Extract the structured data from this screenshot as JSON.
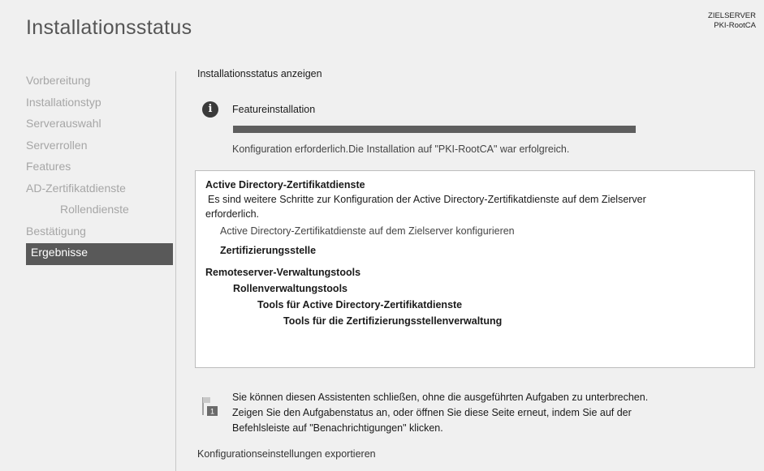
{
  "header": {
    "title": "Installationsstatus",
    "target_server_label": "ZIELSERVER",
    "target_server_name": "PKI-RootCA"
  },
  "sidebar": {
    "items": [
      {
        "label": "Vorbereitung"
      },
      {
        "label": "Installationstyp"
      },
      {
        "label": "Serverauswahl"
      },
      {
        "label": "Serverrollen"
      },
      {
        "label": "Features"
      },
      {
        "label": "AD-Zertifikatdienste"
      },
      {
        "label": "Rollendienste"
      },
      {
        "label": "Bestätigung"
      },
      {
        "label": "Ergebnisse"
      }
    ]
  },
  "main": {
    "heading": "Installationsstatus anzeigen",
    "feature_label": "Featureinstallation",
    "progress_fraction": 1.0,
    "status_text": "Konfiguration erforderlich.Die Installation auf \"PKI-RootCA\" war erfolgreich.",
    "results": {
      "line1": "Active Directory-Zertifikatdienste",
      "line2": "Es sind weitere Schritte zur Konfiguration der Active Directory-Zertifikatdienste auf dem Zielserver",
      "line3": "erforderlich.",
      "line4": "Active Directory-Zertifikatdienste auf dem Zielserver konfigurieren",
      "line5": "Zertifizierungsstelle",
      "line6": "Remoteserver-Verwaltungstools",
      "line7": "Rollenverwaltungstools",
      "line8": "Tools für Active Directory-Zertifikatdienste",
      "line9": "Tools für die Zertifizierungsstellenverwaltung"
    },
    "notice": {
      "line1": "Sie können diesen Assistenten schließen, ohne die ausgeführten Aufgaben zu unterbrechen.",
      "line2": "Zeigen Sie den Aufgabenstatus an, oder öffnen Sie diese Seite erneut, indem Sie auf der",
      "line3": "Befehlsleiste auf \"Benachrichtigungen\" klicken.",
      "badge": "1"
    },
    "export_link": "Konfigurationseinstellungen exportieren"
  },
  "colors": {
    "active_nav_bg": "#595959",
    "progress_bar": "#5e5e5e",
    "inactive_nav_text": "#a6a6a6"
  }
}
